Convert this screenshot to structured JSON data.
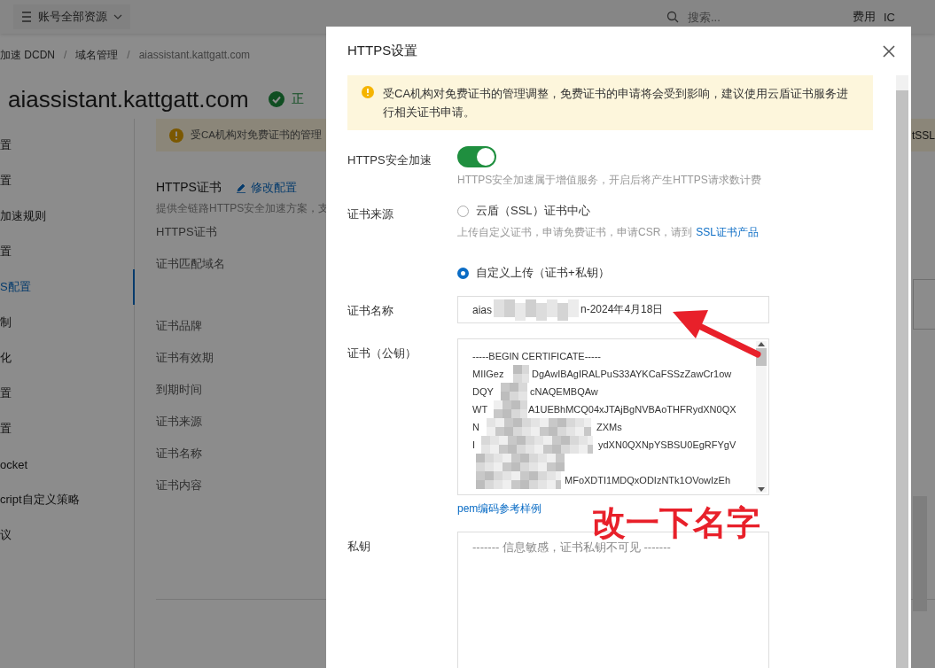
{
  "top_bar": {
    "account_menu": "账号全部资源",
    "search": {
      "placeholder": "搜索..."
    },
    "links": [
      "费用",
      "IC"
    ]
  },
  "breadcrumb": {
    "separator": "/",
    "items": [
      "加速 DCDN",
      "域名管理",
      "aiassistant.kattgatt.com"
    ]
  },
  "domain": {
    "title": "aiassistant.kattgatt.com",
    "status": "正"
  },
  "sidebar": {
    "items": [
      {
        "label": "置",
        "selected": false
      },
      {
        "label": "置",
        "selected": false
      },
      {
        "label": "加速规则",
        "selected": false
      },
      {
        "label": "置",
        "selected": false
      },
      {
        "label": "S配置",
        "selected": true
      },
      {
        "label": "制",
        "selected": false
      },
      {
        "label": "化",
        "selected": false
      },
      {
        "label": "置",
        "selected": false
      },
      {
        "label": "置",
        "selected": false
      },
      {
        "label": "ocket",
        "selected": false
      },
      {
        "label": "cript自定义策略",
        "selected": false
      },
      {
        "label": "议",
        "selected": false
      }
    ]
  },
  "content": {
    "alert": "受CA机构对免费证书的管理",
    "alert_end": "tSSL",
    "section_title": "HTTPS证书",
    "edit_link": "修改配置",
    "description": "提供全链路HTTPS安全加速方案，支",
    "fields": [
      "HTTPS证书",
      "证书匹配域名",
      "证书品牌",
      "证书有效期",
      "到期时间",
      "证书来源",
      "证书名称",
      "证书内容"
    ]
  },
  "dialog": {
    "title": "HTTPS设置",
    "notice": "受CA机构对免费证书的管理调整，免费证书的申请将会受到影响，建议使用云盾证书服务进行相关证书申请。",
    "https_acceleration": {
      "label": "HTTPS安全加速",
      "on": true,
      "hint": "HTTPS安全加速属于增值服务，开启后将产生HTTPS请求数计费"
    },
    "certificate_source": {
      "label": "证书来源",
      "options": [
        {
          "label": "云盾（SSL）证书中心",
          "selected": false,
          "hint": "上传自定义证书，申请免费证书，申请CSR，请到",
          "hint_link": "SSL证书产品"
        },
        {
          "label": "自定义上传（证书+私钥）",
          "selected": true
        }
      ]
    },
    "certificate_name": {
      "label": "证书名称",
      "value_start": "aias",
      "value_end": "n-2024年4月18日"
    },
    "certificate": {
      "label": "证书（公钥）",
      "lines": [
        {
          "left": "-----BEGIN CERTIFICATE-----"
        },
        {
          "left": "MIIGez",
          "right": "DgAwIBAgIRALPuS33AYKCaFSSzZawCr1ow"
        },
        {
          "left": "DQY",
          "right": "cNAQEMBQAw"
        },
        {
          "left": "WT",
          "right": "A1UEBhMCQ04xJTAjBgNVBAoTHFRydXN0QX"
        },
        {
          "left": "N",
          "right": "ZXMs"
        },
        {
          "left": "I",
          "right": "ydXN0QXNpYSBSU0EgRFYgV"
        },
        {
          "right": "MFoXDTI1MDQxODIzNTk1OVowIzEh"
        }
      ],
      "link": "pem编码参考样例"
    },
    "private_key": {
      "label": "私钥",
      "placeholder": "------- 信息敏感，证书私钥不可见 -------"
    }
  },
  "annotation": {
    "text": "改一下名字"
  }
}
